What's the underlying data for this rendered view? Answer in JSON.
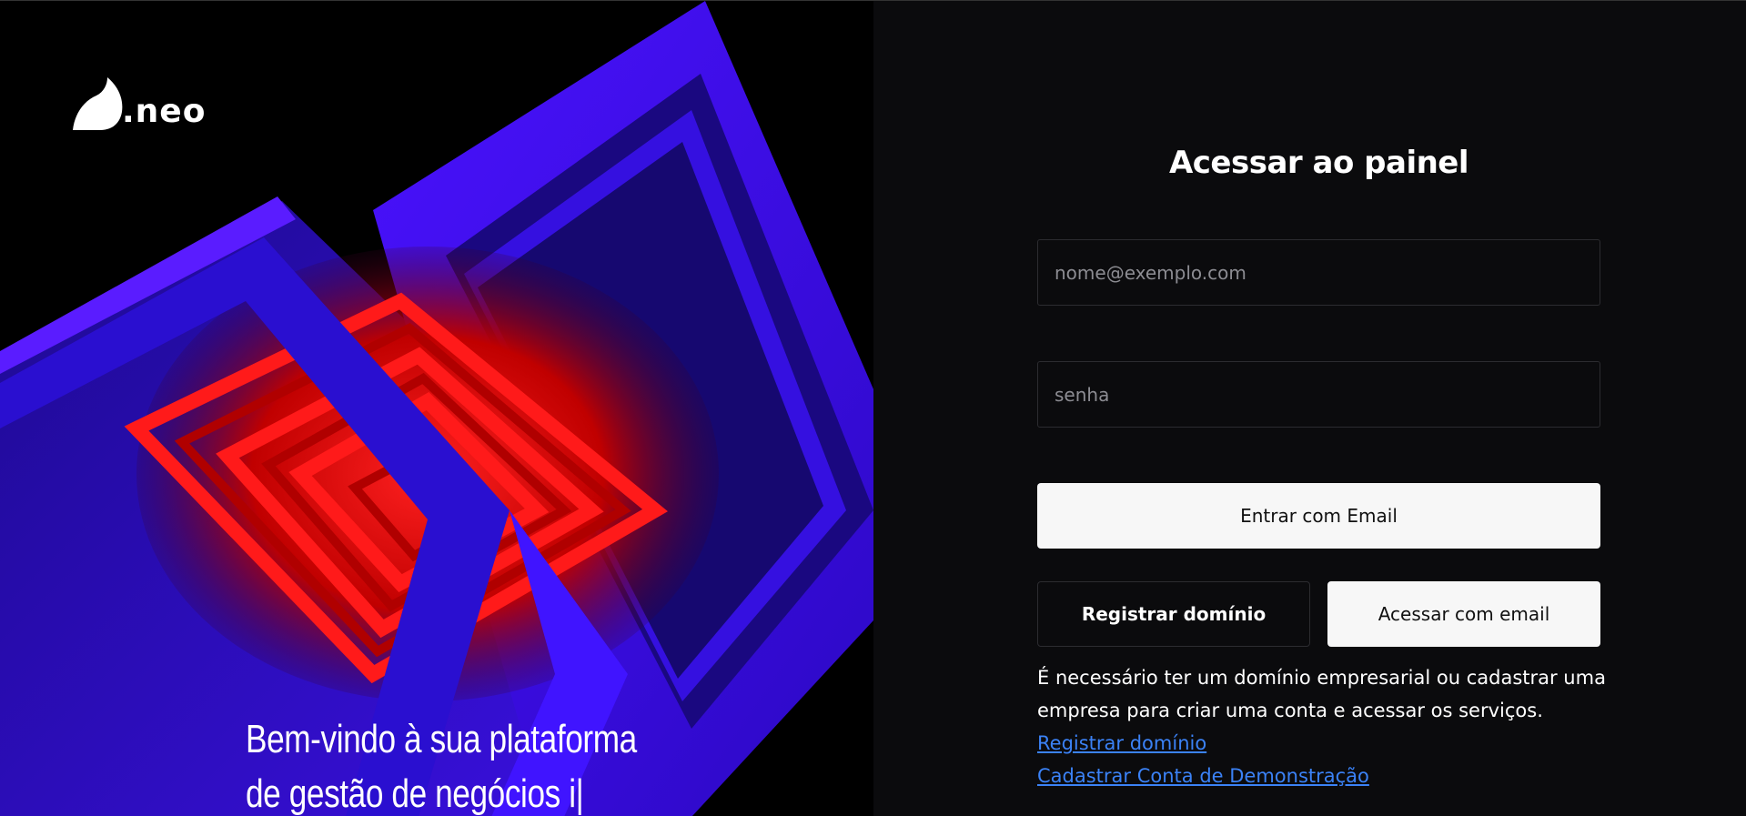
{
  "brand": {
    "name": ".neo",
    "logo_icon": "half-moon-logo-icon"
  },
  "hero": {
    "tagline_line1": "Bem-vindo à sua plataforma",
    "tagline_line2": "de gestão de negócios i|",
    "image": "3d-cube-tunnel-artwork"
  },
  "login": {
    "title": "Acessar ao painel",
    "email_placeholder": "nome@exemplo.com",
    "password_placeholder": "senha",
    "submit_label": "Entrar com Email",
    "register_domain_label": "Registrar domínio",
    "email_access_label": "Acessar com email",
    "info_text": "É necessário ter um domínio empresarial ou cadastrar uma empresa para criar uma conta e acessar os serviços.",
    "register_domain_link": "Registrar domínio",
    "demo_account_link": "Cadastrar Conta de Demonstração"
  },
  "colors": {
    "background": "#0b0b0d",
    "primary_button": "#f7f7f7",
    "link": "#3b82f6",
    "cube_blue": "#3a10f0",
    "tunnel_red": "#ff1010"
  }
}
